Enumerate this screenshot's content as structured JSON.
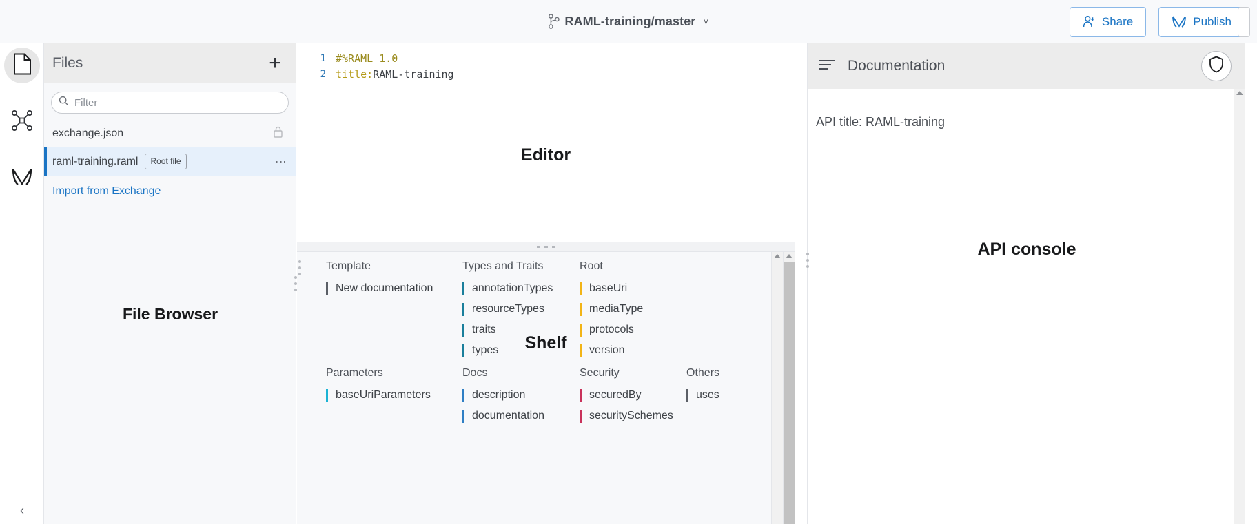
{
  "topbar": {
    "branch_icon": "git-branch-icon",
    "branch_label": "RAML-training/master",
    "chevron": "˅",
    "share_label": "Share",
    "publish_label": "Publish"
  },
  "rail": {
    "items": [
      {
        "name": "files",
        "icon": "file-icon",
        "active": true
      },
      {
        "name": "project-graph",
        "icon": "nodes-graph-icon",
        "active": false
      },
      {
        "name": "exchange",
        "icon": "mulesoft-icon",
        "active": false
      }
    ],
    "collapse_icon": "chevron-left-icon",
    "collapse_glyph": "‹"
  },
  "file_browser": {
    "title": "Files",
    "add_glyph": "+",
    "filter": {
      "placeholder": "Filter",
      "value": ""
    },
    "files": [
      {
        "name": "exchange.json",
        "badge": "",
        "locked": true,
        "selected": false
      },
      {
        "name": "raml-training.raml",
        "badge": "Root file",
        "locked": false,
        "selected": true
      }
    ],
    "import_link": "Import from Exchange",
    "watermark": "File Browser"
  },
  "editor": {
    "watermark": "Editor",
    "lines": [
      {
        "number": "1",
        "directive": "#%RAML 1.0",
        "key": "",
        "value": ""
      },
      {
        "number": "2",
        "directive": "",
        "key": "title:",
        "value": " RAML-training"
      }
    ]
  },
  "shelf": {
    "watermark": "Shelf",
    "groups_row1": [
      {
        "heading": "Template",
        "color": "#5b5f66",
        "items": [
          "New documentation"
        ]
      },
      {
        "heading": "Types and Traits",
        "color": "#1a7f9c",
        "items": [
          "annotationTypes",
          "resourceTypes",
          "traits",
          "types"
        ]
      },
      {
        "heading": "Root",
        "color": "#f2b416",
        "items": [
          "baseUri",
          "mediaType",
          "protocols",
          "version"
        ]
      },
      {
        "heading": "",
        "color": "",
        "items": []
      }
    ],
    "groups_row2": [
      {
        "heading": "Parameters",
        "color": "#1bb3d4",
        "items": [
          "baseUriParameters"
        ]
      },
      {
        "heading": "Docs",
        "color": "#2f7fc4",
        "items": [
          "description",
          "documentation"
        ]
      },
      {
        "heading": "Security",
        "color": "#c9325b",
        "items": [
          "securedBy",
          "securitySchemes"
        ]
      },
      {
        "heading": "Others",
        "color": "#5b5f66",
        "items": [
          "uses"
        ]
      }
    ]
  },
  "right_panel": {
    "menu_icon": "list-lines-icon",
    "title": "Documentation",
    "shield_icon": "shield-icon",
    "api_title": "API title: RAML-training",
    "watermark": "API console"
  },
  "colors": {
    "accent_blue": "#1a74c4",
    "selected_row_bg": "#e6f0fb",
    "panel_header_bg": "#ececec",
    "shelf_bg": "#f7f8fa",
    "topbar_bg": "#f8f9fb"
  }
}
